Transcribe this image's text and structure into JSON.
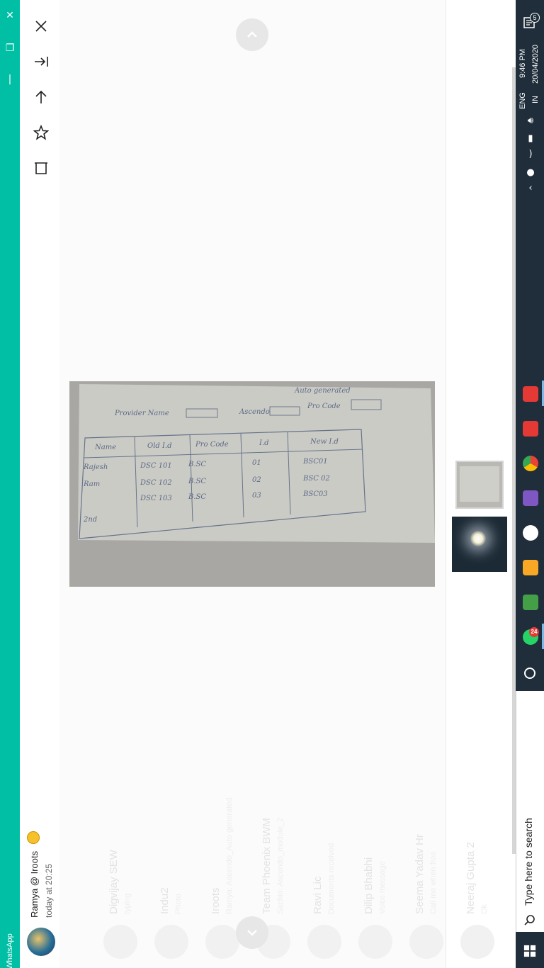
{
  "app": {
    "title": "WhatsApp"
  },
  "viewer": {
    "sender_name": "Ramya @ Iroots",
    "sender_time": "today at 20:25"
  },
  "photo": {
    "header_labels": [
      "Provider Name",
      "Ascendo",
      "Auto generated",
      "Pro Code"
    ],
    "table_headers": [
      "Name",
      "Old I.d",
      "Pro Code",
      "I.d",
      "New I.d"
    ],
    "rows": [
      [
        "Rajesh",
        "DSC 101",
        "B.SC",
        "01",
        "BSC01"
      ],
      [
        "Ram",
        "DSC 102",
        "B.SC",
        "02",
        "BSC 02"
      ],
      [
        "",
        "DSC 103",
        "B.SC",
        "03",
        "BSC03"
      ],
      [
        "2nd",
        "",
        "",
        "",
        ""
      ]
    ]
  },
  "background_chats": [
    {
      "name": "Digvijay SEW",
      "sub": "typing"
    },
    {
      "name": "Indu2",
      "sub": "Photo"
    },
    {
      "name": "Iroots",
      "sub": "Ramya: Ascendo_Auto generated"
    },
    {
      "name": "Team Phoenix BWM",
      "sub": "Sachin: Ascendo_module_2"
    },
    {
      "name": "Ravi Lic",
      "sub": "Documents received"
    },
    {
      "name": "Dilip Bhabhi",
      "sub": "Voice message"
    },
    {
      "name": "Seema Yadav Hr",
      "sub": "Call me when free"
    },
    {
      "name": "Neeraj Gupta 2",
      "sub": "Ok"
    }
  ],
  "taskbar": {
    "search_placeholder": "Type here to search",
    "time": "9:46 PM",
    "date": "20/04/2020",
    "lang_top": "ENG",
    "lang_bottom": "IN",
    "notifications": "5",
    "whatsapp_badge": "24"
  },
  "colors": {
    "whatsapp_green": "#00bfa5",
    "taskbar": "#1f2e3a"
  }
}
